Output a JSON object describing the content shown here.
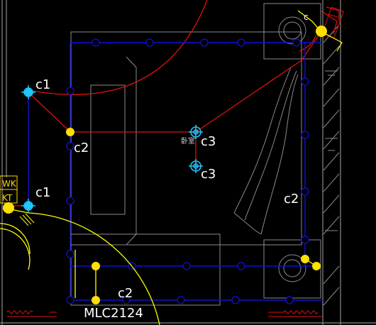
{
  "labels": {
    "c1_top": "c1",
    "c1_left": "c1",
    "c2_left": "c2",
    "c2_right": "c2",
    "c2_bottom": "c2",
    "c3_top": "c3",
    "c3_bottom": "c3",
    "c_corner": "c",
    "window_code": "MLC2124",
    "wk": "WK",
    "kt": "KT",
    "fixture_text": "卧室"
  },
  "colors": {
    "background": "#000000",
    "wiring": "#1010d0",
    "furniture": "#8a8a8a",
    "circuit": "#e01010",
    "door_arc": "#ffff00",
    "fixture_light": "#1ec8ff",
    "junction": "#ffe000",
    "text": "#ffffff"
  }
}
